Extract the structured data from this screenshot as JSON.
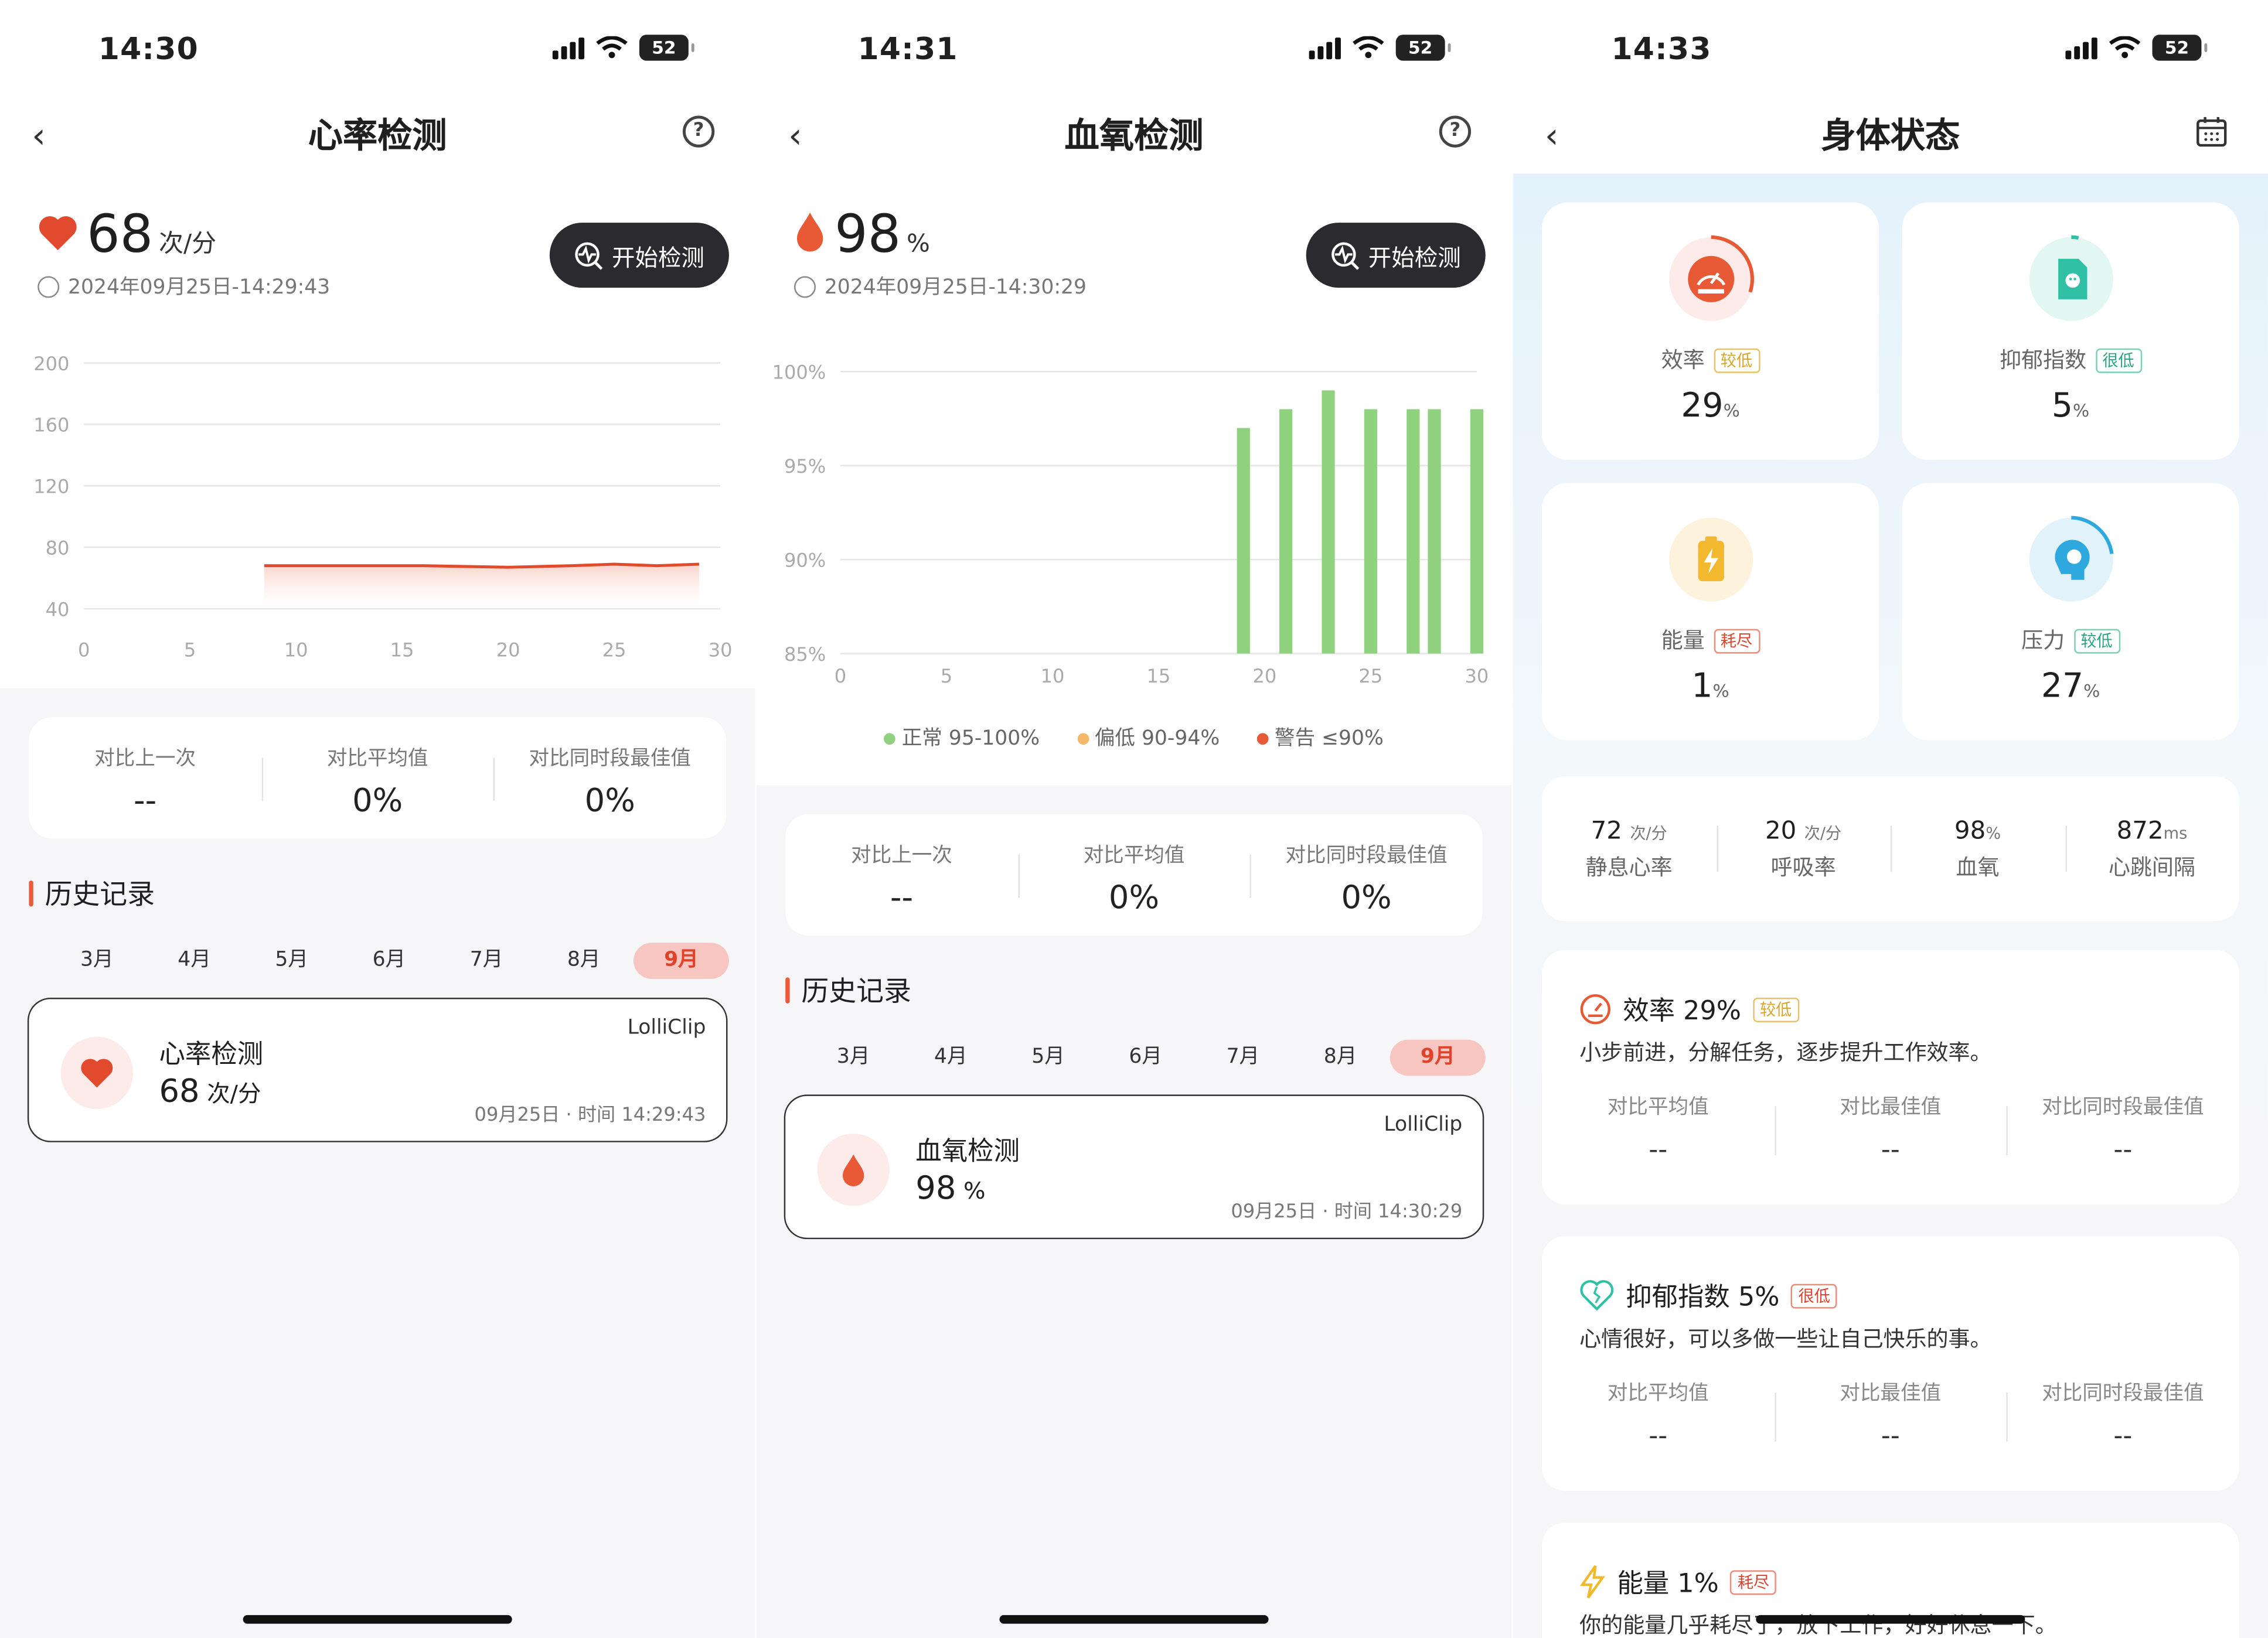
{
  "phones": [
    {
      "status_time": "14:30",
      "battery": "52",
      "title": "心率检测",
      "big_value": "68",
      "big_unit": "次/分",
      "timestamp": "2024年09月25日-14:29:43",
      "start_button": "开始检测",
      "compare": [
        {
          "label": "对比上一次",
          "value": "--"
        },
        {
          "label": "对比平均值",
          "value": "0%"
        },
        {
          "label": "对比同时段最佳值",
          "value": "0%"
        }
      ],
      "history_title": "历史记录",
      "months": [
        "3月",
        "4月",
        "5月",
        "6月",
        "7月",
        "8月",
        "9月"
      ],
      "active_month": "9月",
      "record": {
        "name": "心率检测",
        "value": "68",
        "unit": "次/分",
        "source": "LolliClip",
        "time": "09月25日 · 时间 14:29:43"
      }
    },
    {
      "status_time": "14:31",
      "battery": "52",
      "title": "血氧检测",
      "big_value": "98",
      "big_unit": "%",
      "timestamp": "2024年09月25日-14:30:29",
      "start_button": "开始检测",
      "legend": [
        {
          "label": "正常 95-100%",
          "color": "#8fd17f"
        },
        {
          "label": "偏低 90-94%",
          "color": "#f5b76a"
        },
        {
          "label": "警告 ≤90%",
          "color": "#e85a36"
        }
      ],
      "compare": [
        {
          "label": "对比上一次",
          "value": "--"
        },
        {
          "label": "对比平均值",
          "value": "0%"
        },
        {
          "label": "对比同时段最佳值",
          "value": "0%"
        }
      ],
      "history_title": "历史记录",
      "months": [
        "3月",
        "4月",
        "5月",
        "6月",
        "7月",
        "8月",
        "9月"
      ],
      "active_month": "9月",
      "record": {
        "name": "血氧检测",
        "value": "98",
        "unit": "%",
        "source": "LolliClip",
        "time": "09月25日 · 时间 14:30:29"
      }
    },
    {
      "status_time": "14:33",
      "battery": "52",
      "title": "身体状态",
      "tiles": [
        {
          "label": "效率",
          "tag": "较低",
          "value": "29",
          "unit": "%",
          "color": "#e85a36"
        },
        {
          "label": "抑郁指数",
          "tag": "很低",
          "value": "5",
          "unit": "%",
          "color": "#2fc0a6"
        },
        {
          "label": "能量",
          "tag": "耗尽",
          "value": "1",
          "unit": "%",
          "color": "#f2b82e"
        },
        {
          "label": "压力",
          "tag": "较低",
          "value": "27",
          "unit": "%",
          "color": "#2ea9e0"
        }
      ],
      "vitals": [
        {
          "value": "72",
          "unit": "次/分",
          "label": "静息心率"
        },
        {
          "value": "20",
          "unit": "次/分",
          "label": "呼吸率"
        },
        {
          "value": "98",
          "unit": "%",
          "label": "血氧"
        },
        {
          "value": "872",
          "unit": "ms",
          "label": "心跳间隔"
        }
      ],
      "details": [
        {
          "title": "效率 29%",
          "tag": "较低",
          "desc": "小步前进，分解任务，逐步提升工作效率。",
          "cols": [
            {
              "label": "对比平均值",
              "value": "--"
            },
            {
              "label": "对比最佳值",
              "value": "--"
            },
            {
              "label": "对比同时段最佳值",
              "value": "--"
            }
          ]
        },
        {
          "title": "抑郁指数 5%",
          "tag": "很低",
          "desc": "心情很好，可以多做一些让自己快乐的事。",
          "cols": [
            {
              "label": "对比平均值",
              "value": "--"
            },
            {
              "label": "对比最佳值",
              "value": "--"
            },
            {
              "label": "对比同时段最佳值",
              "value": "--"
            }
          ]
        },
        {
          "title": "能量 1%",
          "tag": "耗尽",
          "desc": "你的能量几乎耗尽了，放下工作，好好休息一下。"
        }
      ]
    }
  ],
  "chart_data": [
    {
      "type": "line",
      "x_ticks": [
        "0",
        "5",
        "10",
        "15",
        "20",
        "25",
        "30"
      ],
      "y_ticks": [
        "200",
        "160",
        "120",
        "80",
        "40"
      ],
      "xlim": [
        0,
        30
      ],
      "ylim": [
        40,
        200
      ],
      "series": [
        {
          "x": [
            8.5,
            12,
            16,
            20,
            23,
            25,
            27,
            29
          ],
          "y": [
            68,
            68,
            68,
            67,
            68,
            69,
            68,
            69
          ]
        }
      ],
      "color": "#e24a2e"
    },
    {
      "type": "bar",
      "x_ticks": [
        "0",
        "5",
        "10",
        "15",
        "20",
        "25",
        "30"
      ],
      "y_ticks": [
        "100%",
        "95%",
        "90%",
        "85%"
      ],
      "xlim": [
        0,
        30
      ],
      "ylim": [
        85,
        100
      ],
      "x": [
        19,
        21,
        23,
        25,
        27,
        28,
        30
      ],
      "values": [
        97,
        98,
        99,
        98,
        98,
        98,
        98
      ],
      "color": "#8fd17f"
    }
  ]
}
